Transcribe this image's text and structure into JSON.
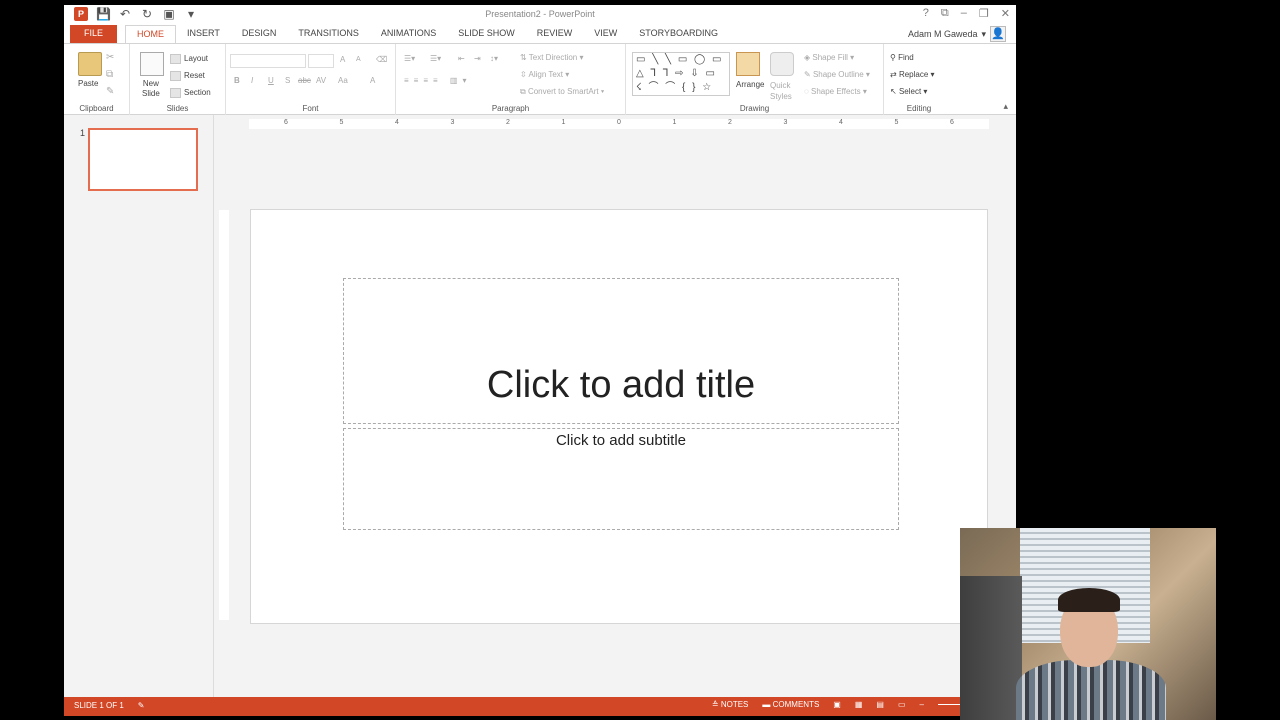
{
  "window": {
    "title": "Presentation2 - PowerPoint",
    "controls": [
      "?",
      "⧉",
      "–",
      "❐",
      "✕"
    ]
  },
  "qat": {
    "app_icon": "P",
    "save_icon": "save-icon",
    "undo_icon": "undo-icon",
    "redo_icon": "repeat-icon",
    "present_icon": "start-from-beginning-icon"
  },
  "tabs": [
    "FILE",
    "HOME",
    "INSERT",
    "DESIGN",
    "TRANSITIONS",
    "ANIMATIONS",
    "SLIDE SHOW",
    "REVIEW",
    "VIEW",
    "STORYBOARDING"
  ],
  "active_tab": "HOME",
  "user": {
    "name": "Adam M Gaweda",
    "dropdown": "▾"
  },
  "ribbon": {
    "clipboard": {
      "label": "Clipboard",
      "paste": "Paste"
    },
    "slides": {
      "label": "Slides",
      "new_slide_line1": "New",
      "new_slide_line2": "Slide",
      "layout": "Layout",
      "reset": "Reset",
      "section": "Section"
    },
    "font": {
      "label": "Font",
      "bold": "B",
      "italic": "I",
      "underline": "U",
      "shadow": "S",
      "strike": "abc",
      "spacing": "AV",
      "case": "Aa",
      "color": "A",
      "grow": "A",
      "shrink": "A"
    },
    "paragraph": {
      "label": "Paragraph",
      "text_direction": "Text Direction",
      "align_text": "Align Text",
      "smartart": "Convert to SmartArt"
    },
    "drawing": {
      "label": "Drawing",
      "shapes_row1": "▭ ╲ ╲ ▭ ◯ ▭",
      "shapes_row2": "△ ⅂ ⅂ ⇨ ⇩ ▭",
      "shapes_row3": "☇ ⌒ ⌒ { } ☆",
      "arrange": "Arrange",
      "quick_line1": "Quick",
      "quick_line2": "Styles",
      "shape_fill": "Shape Fill",
      "shape_outline": "Shape Outline",
      "shape_effects": "Shape Effects"
    },
    "editing": {
      "label": "Editing",
      "find": "Find",
      "replace": "Replace",
      "select": "Select"
    }
  },
  "thumbnail": {
    "number": "1"
  },
  "ruler": [
    "6",
    "5",
    "4",
    "3",
    "2",
    "1",
    "0",
    "1",
    "2",
    "3",
    "4",
    "5",
    "6"
  ],
  "slide": {
    "title_placeholder": "Click to add title",
    "subtitle_placeholder": "Click to add subtitle"
  },
  "status": {
    "slide_info": "SLIDE 1 OF 1",
    "notes": "NOTES",
    "comments": "COMMENTS"
  },
  "colors": {
    "accent": "#d24726",
    "selection": "#e46c4f"
  }
}
